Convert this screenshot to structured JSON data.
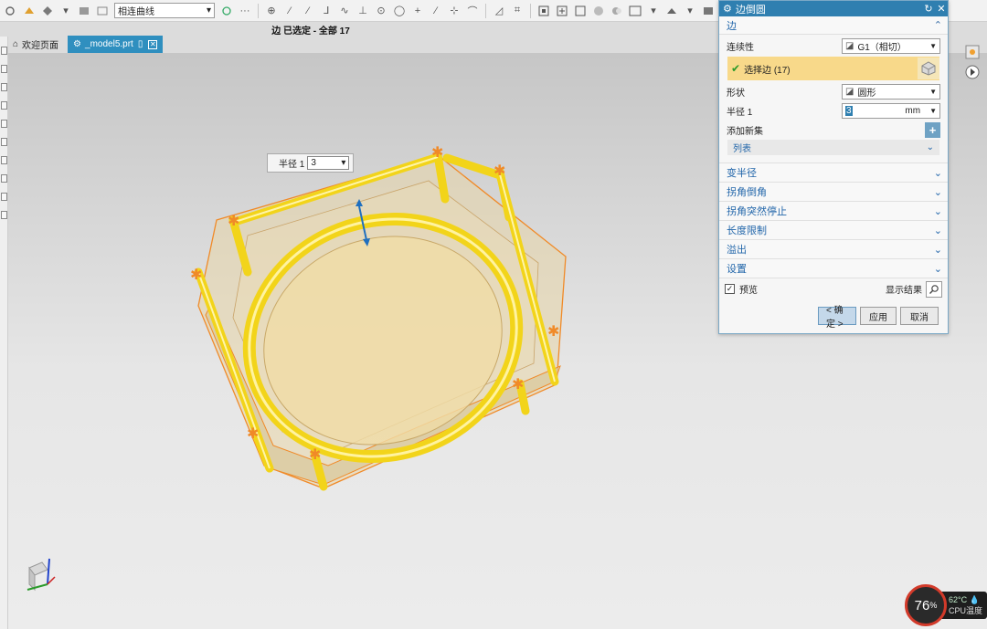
{
  "toolbar": {
    "curve_rule_value": "相连曲线",
    "dots": "···"
  },
  "selection_status": "边 已选定 - 全部 17",
  "tabs": [
    {
      "label": "欢迎页面"
    },
    {
      "label": "_model5.prt"
    }
  ],
  "ongraphics": {
    "label": "半径 1",
    "value": "3"
  },
  "dialog": {
    "title": "边倒圆",
    "edge_group": "边",
    "continuity_label": "连续性",
    "continuity_value": "G1（相切）",
    "select_edge_label": "选择边 (17)",
    "shape_label": "形状",
    "shape_value": "圆形",
    "radius_label": "半径 1",
    "radius_value": "3",
    "radius_unit": "mm",
    "add_set_label": "添加新集",
    "list_label": "列表",
    "sections": [
      "变半径",
      "拐角倒角",
      "拐角突然停止",
      "长度限制",
      "溢出",
      "设置"
    ],
    "preview_label": "预览",
    "show_result_label": "显示结果",
    "ok_label": "< 确定 >",
    "apply_label": "应用",
    "cancel_label": "取消"
  },
  "cpu": {
    "usage": "76",
    "usage_unit": "%",
    "temp": "62°C",
    "temp_label": "CPU温度"
  },
  "colors": {
    "accent": "#2f7fb0",
    "fillet_yellow": "#f2d41a",
    "edge_orange": "#f08a28"
  }
}
